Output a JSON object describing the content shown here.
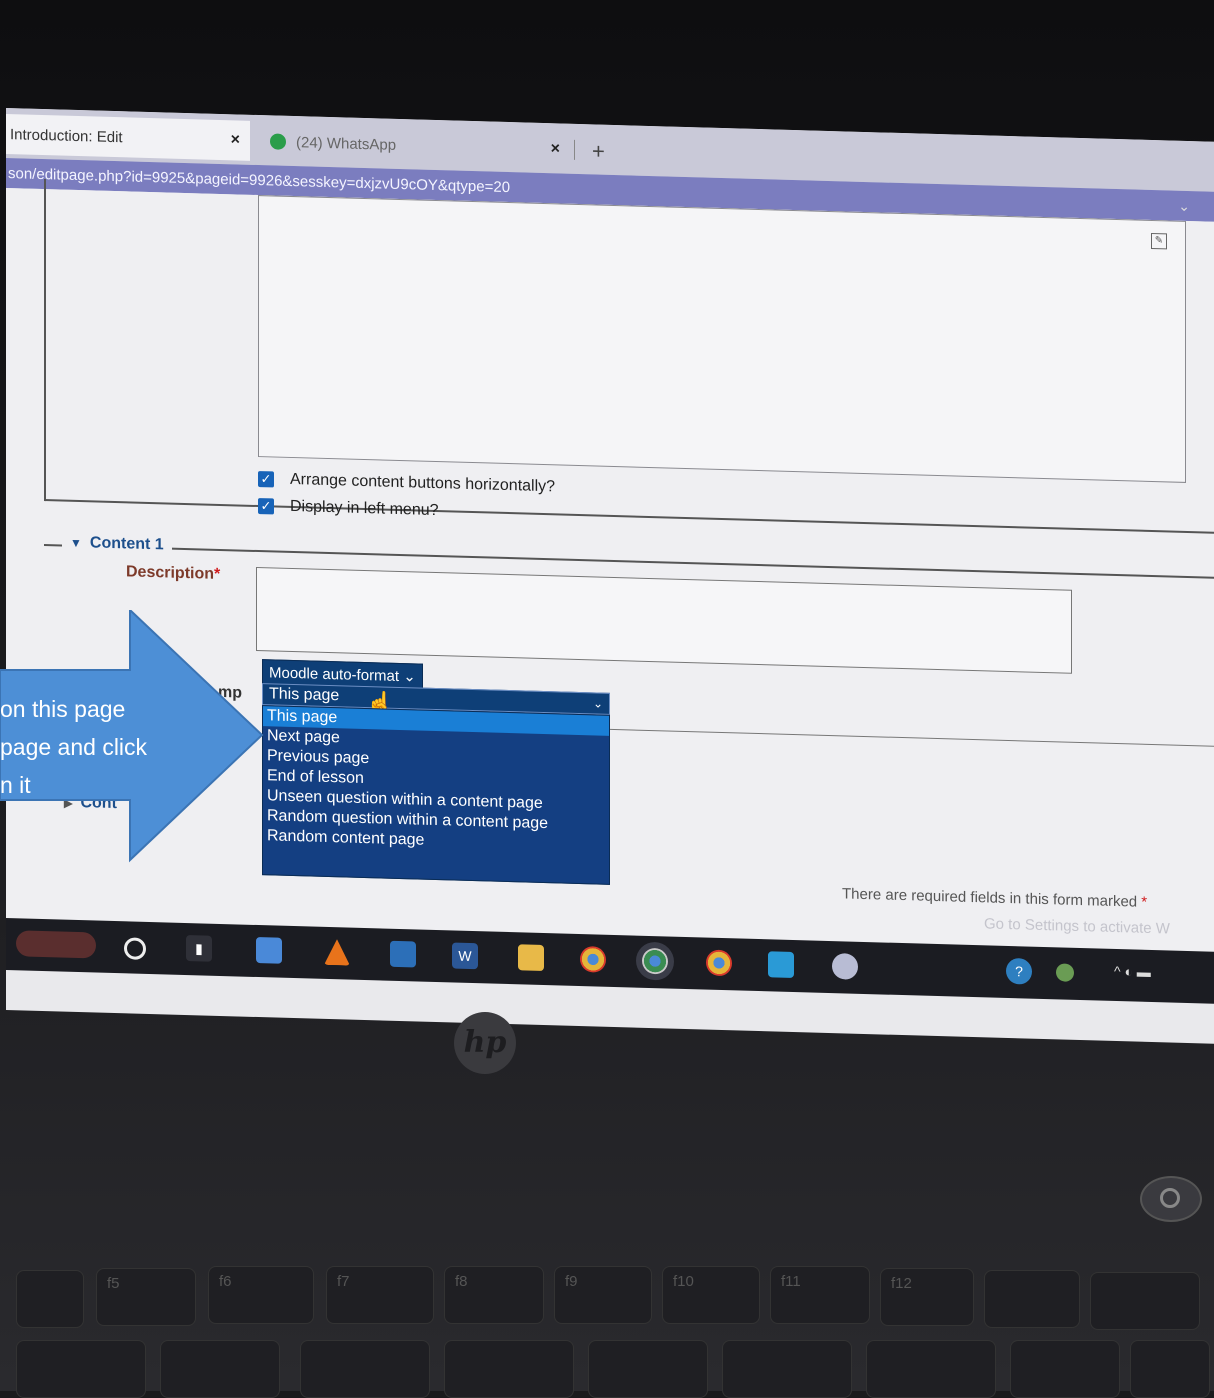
{
  "browser": {
    "tabs": [
      {
        "label": "Introduction: Edit",
        "close": "×"
      },
      {
        "label": "(24) WhatsApp",
        "close": "×"
      }
    ],
    "new_tab": "+",
    "url": "son/editpage.php?id=9925&pageid=9926&sesskey=dxjzvU9cOY&qtype=20"
  },
  "form": {
    "checkbox_1": "Arrange content buttons horizontally?",
    "checkbox_2": "Display in left menu?",
    "section_title": "Content 1",
    "description_label": "Description",
    "required_mark": "*",
    "format_select": "Moodle auto-format",
    "jump_label": "mp",
    "jump_value": "This page",
    "jump_options": [
      "This page",
      "Next page",
      "Previous page",
      "End of lesson",
      "Unseen question within a content page",
      "Random question within a content page",
      "Random content page"
    ],
    "collapsed_section": "Cont",
    "required_note": "There are required fields in this form marked",
    "activate_watermark": "Go to Settings to activate W"
  },
  "annotation": {
    "lines": [
      "on this page",
      "page and click",
      "n it"
    ],
    "color": "#4d8fd6"
  },
  "taskbar": {
    "icons": [
      "search-icon",
      "task-view-icon",
      "store-icon",
      "vlc-icon",
      "mail-icon",
      "word-icon",
      "file-explorer-icon",
      "chrome-icon",
      "chrome-alt-icon",
      "chrome-icon-2",
      "photos-icon",
      "cloud-icon",
      "help-icon",
      "weather-icon",
      "tray-icons"
    ]
  },
  "keyboard": {
    "function_keys": [
      "f5",
      "f6",
      "f7",
      "f8",
      "f9",
      "f10",
      "f11",
      "f12"
    ]
  }
}
